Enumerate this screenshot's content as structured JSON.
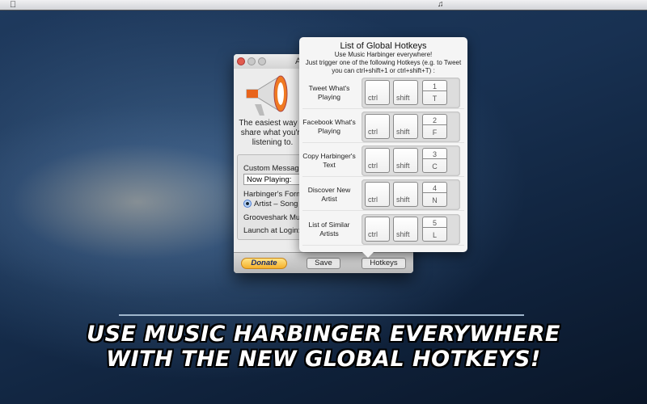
{
  "menubar": {
    "apple_icon": "apple-icon",
    "status_icon": "music-harbinger-menu-icon"
  },
  "window": {
    "title": "Al",
    "blurb": "The easiest way to share what you're listening to.",
    "custom_message_label": "Custom Message",
    "custom_message_value": "Now Playing:",
    "format_label": "Harbinger's Forma",
    "format_option": "Artist – Song N",
    "grooveshark_label": "Grooveshark Musi",
    "launch_label": "Launch at Login:",
    "buttons": {
      "donate": "Donate",
      "save": "Save",
      "hotkeys": "Hotkeys"
    }
  },
  "popover": {
    "title": "List of Global Hotkeys",
    "subtitle": "Use Music Harbinger everywhere!",
    "instructions": "Just trigger one of the following Hotkeys (e.g. to Tweet you can ctrl+shift+1 or ctrl+shift+T) :",
    "rows": [
      {
        "label": "Tweet What's Playing",
        "ctrl": "ctrl",
        "shift": "shift",
        "num": "1",
        "letter": "T"
      },
      {
        "label": "Facebook What's Playing",
        "ctrl": "ctrl",
        "shift": "shift",
        "num": "2",
        "letter": "F"
      },
      {
        "label": "Copy Harbinger's Text",
        "ctrl": "ctrl",
        "shift": "shift",
        "num": "3",
        "letter": "C"
      },
      {
        "label": "Discover New Artist",
        "ctrl": "ctrl",
        "shift": "shift",
        "num": "4",
        "letter": "N"
      },
      {
        "label": "List of Similar Artists",
        "ctrl": "ctrl",
        "shift": "shift",
        "num": "5",
        "letter": "L"
      }
    ]
  },
  "caption": {
    "line1": "USE MUSIC HARBINGER EVERYWHERE",
    "line2": "WITH THE NEW GLOBAL HOTKEYS!"
  }
}
